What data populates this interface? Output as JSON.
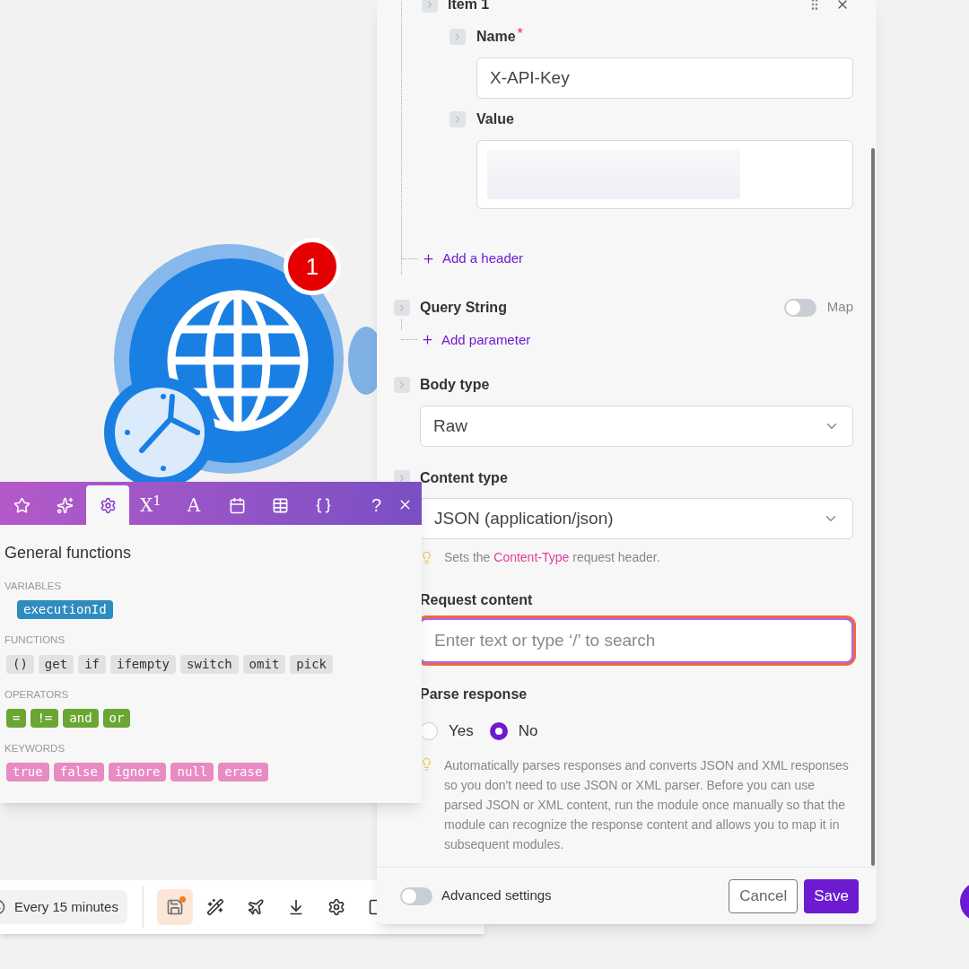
{
  "node": {
    "badge": "1"
  },
  "toolbar": {
    "schedule": "Every 15 minutes",
    "unsaved": true,
    "tools": [
      {
        "selected": true
      },
      {
        "selected": false
      },
      {
        "selected": false
      },
      {
        "selected": false
      },
      {
        "selected": false
      },
      {
        "selected": false
      }
    ]
  },
  "panel": {
    "item": {
      "label": "Item 1",
      "fields": [
        {
          "label": "Name",
          "required_mark": "*",
          "kind": "input",
          "value": "X-API-Key"
        },
        {
          "label": "Value",
          "kind": "blurred"
        }
      ]
    },
    "add_header": "Add a header",
    "query_string": {
      "label": "Query String",
      "map_label": "Map",
      "map_on": false,
      "add_label": "Add parameter"
    },
    "body_type": {
      "label": "Body type",
      "value": "Raw"
    },
    "content_type": {
      "label": "Content type",
      "value": "JSON (application/json)",
      "hint_before": "Sets the",
      "hint_code": "Content-Type",
      "hint_after": "request header."
    },
    "request_content": {
      "label": "Request content",
      "placeholder": "Enter text or type ‘/’ to search",
      "focused": true
    },
    "parse_response": {
      "label": "Parse response",
      "options": [
        {
          "label": "Yes",
          "selected": false
        },
        {
          "label": "No",
          "selected": true
        }
      ],
      "hint": "Automatically parses responses and converts JSON and XML responses so you don't need to use JSON or XML parser. Before you can use parsed JSON or XML content, run the module once manually so that the module can recognize the response content and allows you to map it in subsequent modules."
    },
    "advanced_settings": {
      "label": "Advanced settings",
      "on": false
    },
    "cancel": "Cancel",
    "save": "Save"
  },
  "function_picker": {
    "tabs": [
      {
        "selected": false
      },
      {
        "selected": false
      },
      {
        "selected": true
      },
      {
        "selected": false,
        "label": "X$^{1}$"
      },
      {
        "selected": false,
        "label": "A"
      },
      {
        "selected": false
      },
      {
        "selected": false
      },
      {
        "selected": false
      }
    ],
    "help": "?",
    "title": "General functions",
    "sections": [
      {
        "title": "VARIABLES",
        "kind": "variable",
        "items": [
          "executionId"
        ]
      },
      {
        "title": "FUNCTIONS",
        "kind": "function",
        "items": [
          "()",
          "get",
          "if",
          "ifempty",
          "switch",
          "omit",
          "pick"
        ]
      },
      {
        "title": "OPERATORS",
        "kind": "operator",
        "items": [
          "=",
          "!=",
          "and",
          "or"
        ]
      },
      {
        "title": "KEYWORDS",
        "kind": "keyword",
        "items": [
          "true",
          "false",
          "ignore",
          "null",
          "erase"
        ]
      }
    ]
  }
}
